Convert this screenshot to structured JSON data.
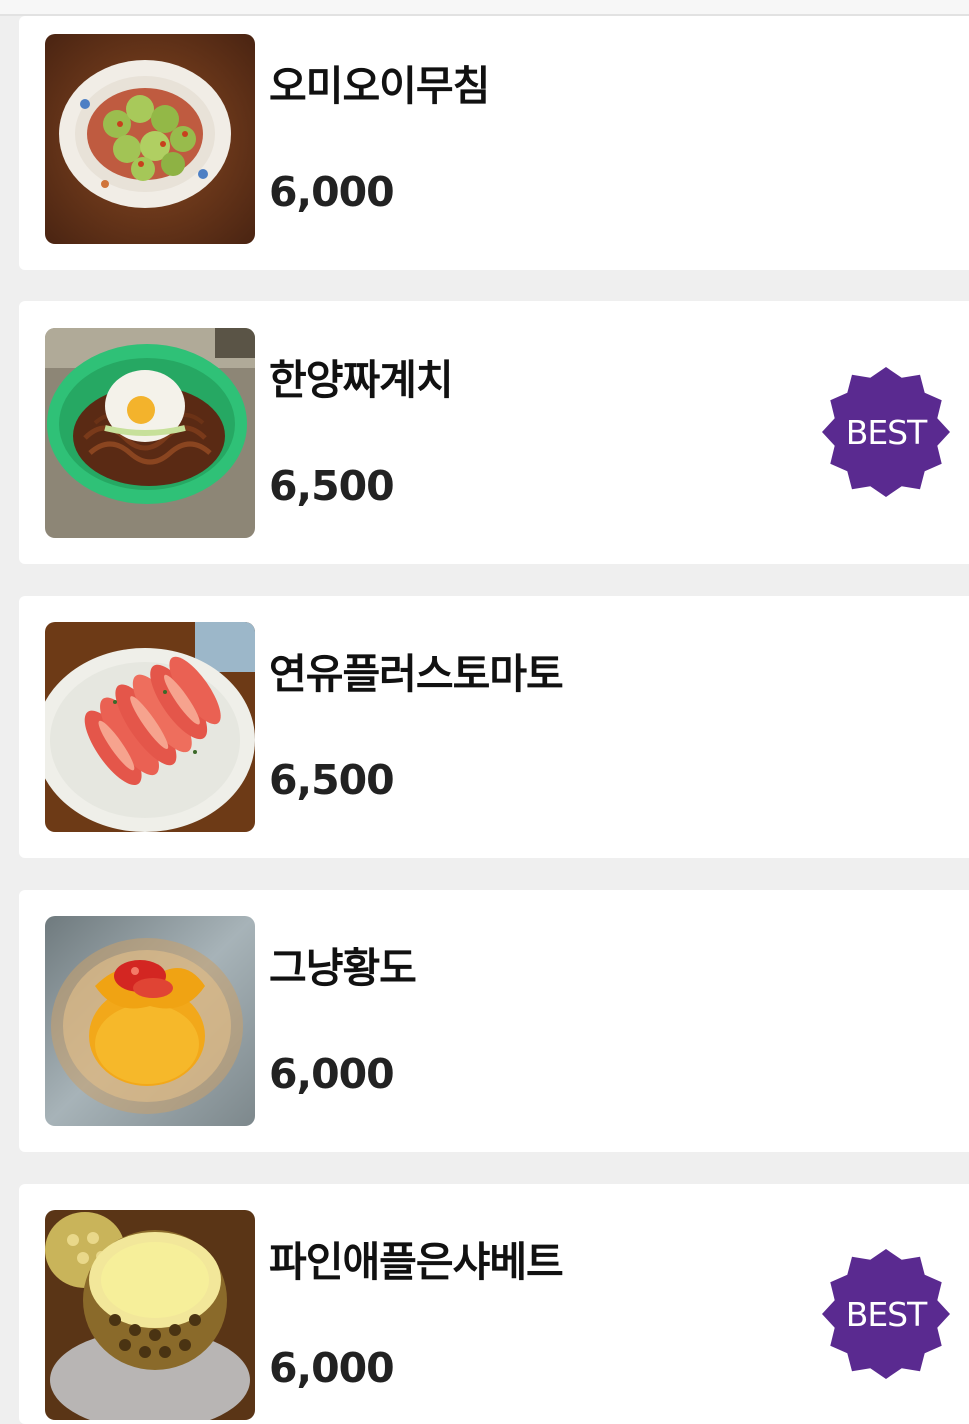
{
  "colors": {
    "page_background": "#efefef",
    "card_background": "#ffffff",
    "text": "#111111",
    "badge": "#5a2a90",
    "badge_text": "#ffffff"
  },
  "menu": {
    "items": [
      {
        "name": "오미오이무침",
        "price": "6,000",
        "image_icon": "cucumber-salad-photo",
        "badge": ""
      },
      {
        "name": "한양짜계치",
        "price": "6,500",
        "image_icon": "jjajang-ramen-egg-photo",
        "badge": "BEST"
      },
      {
        "name": "연유플러스토마토",
        "price": "6,500",
        "image_icon": "sliced-tomato-photo",
        "badge": ""
      },
      {
        "name": "그냥황도",
        "price": "6,000",
        "image_icon": "yellow-peach-photo",
        "badge": ""
      },
      {
        "name": "파인애플은샤베트",
        "price": "6,000",
        "image_icon": "pineapple-sherbet-photo",
        "badge": "BEST"
      }
    ]
  }
}
